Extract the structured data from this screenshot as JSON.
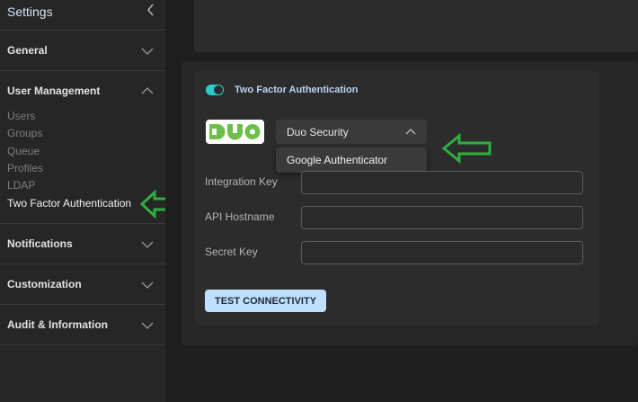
{
  "sidebar": {
    "title": "Settings",
    "sections": [
      {
        "label": "General"
      },
      {
        "label": "User Management"
      },
      {
        "label": "Notifications"
      },
      {
        "label": "Customization"
      },
      {
        "label": "Audit & Information"
      }
    ],
    "user_management_items": [
      {
        "label": "Users"
      },
      {
        "label": "Groups"
      },
      {
        "label": "Queue"
      },
      {
        "label": "Profiles"
      },
      {
        "label": "LDAP"
      },
      {
        "label": "Two Factor Authentication"
      }
    ]
  },
  "main": {
    "tfa": {
      "title": "Two Factor Authentication",
      "enabled": true,
      "provider_logo_text": "DUO",
      "provider_select": {
        "value": "Duo Security",
        "options": [
          "Google Authenticator"
        ]
      },
      "fields": [
        {
          "label": "Integration Key",
          "value": ""
        },
        {
          "label": "API Hostname",
          "value": ""
        },
        {
          "label": "Secret Key",
          "value": ""
        }
      ],
      "test_button": "TEST CONNECTIVITY"
    }
  },
  "colors": {
    "accent_toggle": "#2ec9cc",
    "button_bg": "#bfe0ff",
    "annotation_arrow": "#2fae3f",
    "duo_green": "#6ebe4a"
  }
}
